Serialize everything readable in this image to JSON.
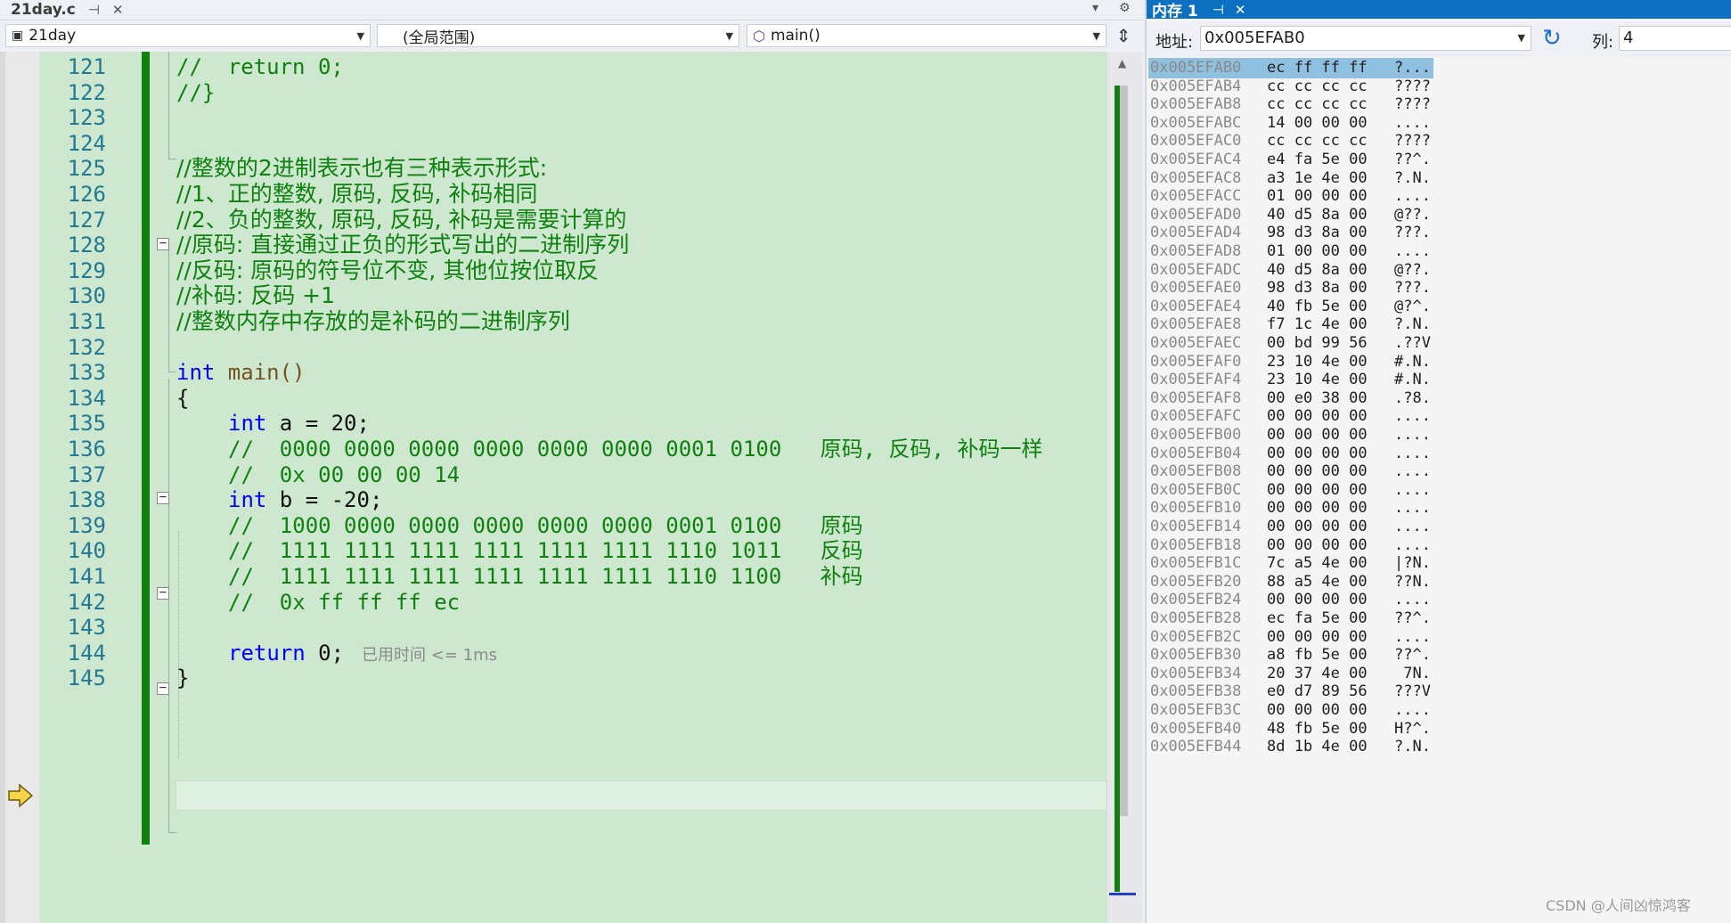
{
  "editor": {
    "tab_title": "21day.c",
    "tab_pin_icon": "pin-icon",
    "tab_close_icon": "close-icon",
    "nav": {
      "project": "21day",
      "scope": "(全局范围)",
      "function": "main()"
    },
    "lines": [
      {
        "no": "121",
        "text": "//  return 0;"
      },
      {
        "no": "122",
        "text": "//}"
      },
      {
        "no": "123",
        "text": ""
      },
      {
        "no": "124",
        "text": ""
      },
      {
        "no": "125",
        "text": "//整数的2进制表示也有三种表示形式:"
      },
      {
        "no": "126",
        "text": "//1、正的整数, 原码, 反码, 补码相同"
      },
      {
        "no": "127",
        "text": "//2、负的整数, 原码, 反码, 补码是需要计算的"
      },
      {
        "no": "128",
        "text": "//原码: 直接通过正负的形式写出的二进制序列"
      },
      {
        "no": "129",
        "text": "//反码: 原码的符号位不变, 其他位按位取反"
      },
      {
        "no": "130",
        "text": "//补码: 反码 +1"
      },
      {
        "no": "131",
        "text": "//整数内存中存放的是补码的二进制序列"
      },
      {
        "no": "132",
        "text": ""
      },
      {
        "no": "133",
        "kw": "int",
        "rest": " main()"
      },
      {
        "no": "134",
        "text": "{"
      },
      {
        "no": "135",
        "kw": "int",
        "rest": " a = 20;"
      },
      {
        "no": "136",
        "comment": "//  0000 0000 0000 0000 0000 0000 0001 0100   原码, 反码, 补码一样"
      },
      {
        "no": "137",
        "comment": "//  0x 00 00 00 14"
      },
      {
        "no": "138",
        "kw": "int",
        "rest": " b = -20;"
      },
      {
        "no": "139",
        "comment": "//  1000 0000 0000 0000 0000 0000 0001 0100   原码"
      },
      {
        "no": "140",
        "comment": "//  1111 1111 1111 1111 1111 1111 1110 1011   反码"
      },
      {
        "no": "141",
        "comment": "//  1111 1111 1111 1111 1111 1111 1110 1100   补码"
      },
      {
        "no": "142",
        "comment": "//  0x ff ff ff ec"
      },
      {
        "no": "143",
        "text": ""
      },
      {
        "no": "144",
        "kw": "return",
        "rest": " 0;",
        "hint": "已用时间 <= 1ms"
      },
      {
        "no": "145",
        "text": "}"
      }
    ]
  },
  "memory": {
    "title": "内存 1",
    "address_label": "地址:",
    "address_value": "0x005EFAB0",
    "columns_label": "列:",
    "columns_value": "4",
    "rows": [
      {
        "addr": "0x005EFAB0",
        "bytes": "ec ff ff ff",
        "chars": "?..."
      },
      {
        "addr": "0x005EFAB4",
        "bytes": "cc cc cc cc",
        "chars": "????"
      },
      {
        "addr": "0x005EFAB8",
        "bytes": "cc cc cc cc",
        "chars": "????"
      },
      {
        "addr": "0x005EFABC",
        "bytes": "14 00 00 00",
        "chars": "...."
      },
      {
        "addr": "0x005EFAC0",
        "bytes": "cc cc cc cc",
        "chars": "????"
      },
      {
        "addr": "0x005EFAC4",
        "bytes": "e4 fa 5e 00",
        "chars": "??^."
      },
      {
        "addr": "0x005EFAC8",
        "bytes": "a3 1e 4e 00",
        "chars": "?.N."
      },
      {
        "addr": "0x005EFACC",
        "bytes": "01 00 00 00",
        "chars": "...."
      },
      {
        "addr": "0x005EFAD0",
        "bytes": "40 d5 8a 00",
        "chars": "@??."
      },
      {
        "addr": "0x005EFAD4",
        "bytes": "98 d3 8a 00",
        "chars": "???."
      },
      {
        "addr": "0x005EFAD8",
        "bytes": "01 00 00 00",
        "chars": "...."
      },
      {
        "addr": "0x005EFADC",
        "bytes": "40 d5 8a 00",
        "chars": "@??."
      },
      {
        "addr": "0x005EFAE0",
        "bytes": "98 d3 8a 00",
        "chars": "???."
      },
      {
        "addr": "0x005EFAE4",
        "bytes": "40 fb 5e 00",
        "chars": "@?^."
      },
      {
        "addr": "0x005EFAE8",
        "bytes": "f7 1c 4e 00",
        "chars": "?.N."
      },
      {
        "addr": "0x005EFAEC",
        "bytes": "00 bd 99 56",
        "chars": ".??V"
      },
      {
        "addr": "0x005EFAF0",
        "bytes": "23 10 4e 00",
        "chars": "#.N."
      },
      {
        "addr": "0x005EFAF4",
        "bytes": "23 10 4e 00",
        "chars": "#.N."
      },
      {
        "addr": "0x005EFAF8",
        "bytes": "00 e0 38 00",
        "chars": ".?8."
      },
      {
        "addr": "0x005EFAFC",
        "bytes": "00 00 00 00",
        "chars": "...."
      },
      {
        "addr": "0x005EFB00",
        "bytes": "00 00 00 00",
        "chars": "...."
      },
      {
        "addr": "0x005EFB04",
        "bytes": "00 00 00 00",
        "chars": "...."
      },
      {
        "addr": "0x005EFB08",
        "bytes": "00 00 00 00",
        "chars": "...."
      },
      {
        "addr": "0x005EFB0C",
        "bytes": "00 00 00 00",
        "chars": "...."
      },
      {
        "addr": "0x005EFB10",
        "bytes": "00 00 00 00",
        "chars": "...."
      },
      {
        "addr": "0x005EFB14",
        "bytes": "00 00 00 00",
        "chars": "...."
      },
      {
        "addr": "0x005EFB18",
        "bytes": "00 00 00 00",
        "chars": "...."
      },
      {
        "addr": "0x005EFB1C",
        "bytes": "7c a5 4e 00",
        "chars": "|?N."
      },
      {
        "addr": "0x005EFB20",
        "bytes": "88 a5 4e 00",
        "chars": "??N."
      },
      {
        "addr": "0x005EFB24",
        "bytes": "00 00 00 00",
        "chars": "...."
      },
      {
        "addr": "0x005EFB28",
        "bytes": "ec fa 5e 00",
        "chars": "??^."
      },
      {
        "addr": "0x005EFB2C",
        "bytes": "00 00 00 00",
        "chars": "...."
      },
      {
        "addr": "0x005EFB30",
        "bytes": "a8 fb 5e 00",
        "chars": "??^."
      },
      {
        "addr": "0x005EFB34",
        "bytes": "20 37 4e 00",
        "chars": " 7N."
      },
      {
        "addr": "0x005EFB38",
        "bytes": "e0 d7 89 56",
        "chars": "???V"
      },
      {
        "addr": "0x005EFB3C",
        "bytes": "00 00 00 00",
        "chars": "...."
      },
      {
        "addr": "0x005EFB40",
        "bytes": "48 fb 5e 00",
        "chars": "H?^."
      },
      {
        "addr": "0x005EFB44",
        "bytes": "8d 1b 4e 00",
        "chars": "?.N."
      }
    ]
  },
  "watermark": "CSDN @人间凶惊鸿客"
}
